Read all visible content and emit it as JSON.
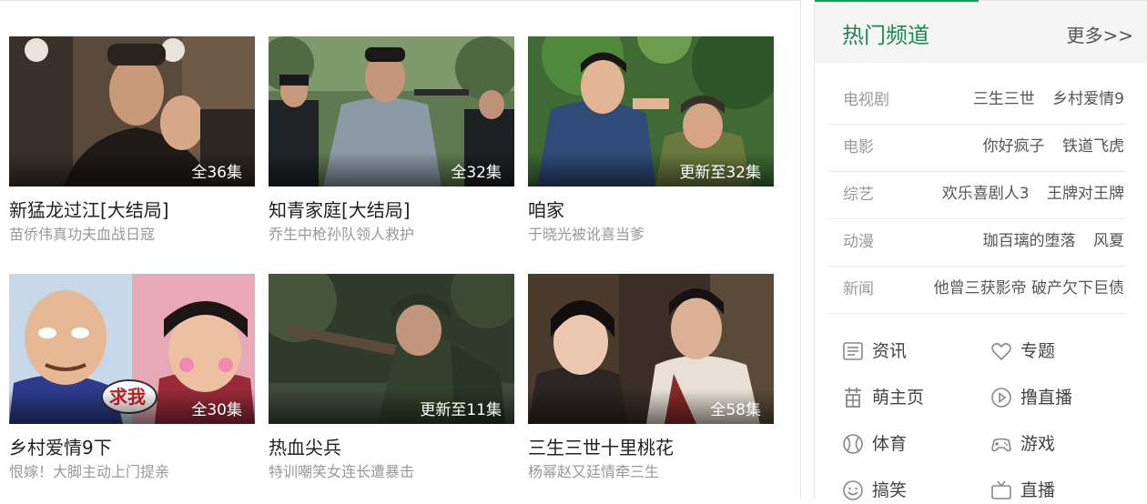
{
  "cards": [
    {
      "title": "新猛龙过江[大结局]",
      "subtitle": "苗侨伟真功夫血战日寇",
      "badge": "全36集"
    },
    {
      "title": "知青家庭[大结局]",
      "subtitle": "乔生中枪孙队领人救护",
      "badge": "全32集"
    },
    {
      "title": "咱家",
      "subtitle": "于晓光被讹喜当爹",
      "badge": "更新至32集"
    },
    {
      "title": "乡村爱情9下",
      "subtitle": "恨嫁！大脚主动上门提亲",
      "badge": "全30集"
    },
    {
      "title": "热血尖兵",
      "subtitle": "特训嘲笑女连长遭暴击",
      "badge": "更新至11集"
    },
    {
      "title": "三生三世十里桃花",
      "subtitle": "杨幂赵又廷情牵三生",
      "badge": "全58集"
    }
  ],
  "thumb_text": {
    "sign": "求我"
  },
  "panel": {
    "title": "热门频道",
    "more": "更多>>",
    "categories": [
      {
        "name": "电视剧",
        "links": [
          "三生三世",
          "乡村爱情9"
        ]
      },
      {
        "name": "电影",
        "links": [
          "你好疯子",
          "铁道飞虎"
        ]
      },
      {
        "name": "综艺",
        "links": [
          "欢乐喜剧人3",
          "王牌对王牌"
        ]
      },
      {
        "name": "动漫",
        "links": [
          "珈百璃的堕落",
          "风夏"
        ]
      },
      {
        "name": "新闻",
        "links": [
          "他曾三获影帝 破产欠下巨债"
        ]
      }
    ],
    "nav": [
      {
        "label": "资讯",
        "icon": "news-icon"
      },
      {
        "label": "专题",
        "icon": "heart-icon"
      },
      {
        "label": "萌主页",
        "icon": "cute-glyph-icon"
      },
      {
        "label": "撸直播",
        "icon": "play-circle-icon"
      },
      {
        "label": "体育",
        "icon": "ball-icon"
      },
      {
        "label": "游戏",
        "icon": "gamepad-icon"
      },
      {
        "label": "搞笑",
        "icon": "smile-icon"
      },
      {
        "label": "直播",
        "icon": "tv-icon"
      }
    ]
  },
  "colors": {
    "accent": "#1b9b5d",
    "title_green": "#1b8a52"
  }
}
